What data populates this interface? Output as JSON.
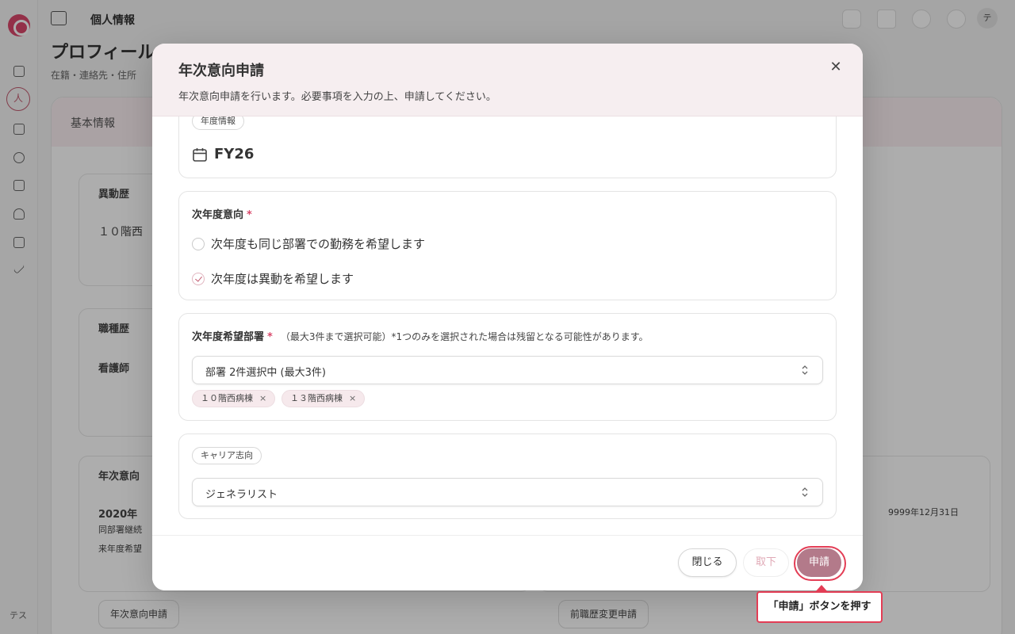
{
  "app": {
    "page_title": "個人情報",
    "heading": "プロフィール",
    "subheading": "在籍・連絡先・住所",
    "main_tab": "基本情報",
    "user_initials": "テス",
    "avatar_initial": "テ",
    "bg_cards": {
      "transfer_history": "異動歴",
      "transfer_value": "１０階西",
      "job_history": "職種歴",
      "job_value": "看護師",
      "annual_intent": "年次意向",
      "intent_year": "2020年",
      "intent_line1": "同部署継続",
      "intent_line2": "来年度希望",
      "right_date": "9999年12月31日",
      "intent_button": "年次意向申請",
      "change_button": "前職歴変更申請"
    }
  },
  "modal": {
    "title": "年次意向申請",
    "description": "年次意向申請を行います。必要事項を入力の上、申請してください。",
    "close_icon": "close-icon",
    "fiscal_year": {
      "label": "年度情報",
      "value": "FY26"
    },
    "intent": {
      "label": "次年度意向",
      "required_mark": "*",
      "options": [
        {
          "label": "次年度も同じ部署での勤務を希望します",
          "checked": false
        },
        {
          "label": "次年度は異動を希望します",
          "checked": true
        }
      ]
    },
    "departments": {
      "label": "次年度希望部署",
      "required_mark": "*",
      "note": "（最大3件まで選択可能）*1つのみを選択された場合は残留となる可能性があります。",
      "select_value": "部署 2件選択中 (最大3件)",
      "tags": [
        "１０階西病棟",
        "１３階西病棟"
      ],
      "tag_remove": "×"
    },
    "career": {
      "label": "キャリア志向",
      "select_value": "ジェネラリスト"
    },
    "footer": {
      "close_label": "閉じる",
      "withdraw_label": "取下",
      "submit_label": "申請"
    }
  },
  "callout": {
    "text": "「申請」ボタンを押す"
  },
  "colors": {
    "accent": "#b37a8a",
    "highlight": "#e33d55",
    "header_bg": "#f6eef0"
  }
}
